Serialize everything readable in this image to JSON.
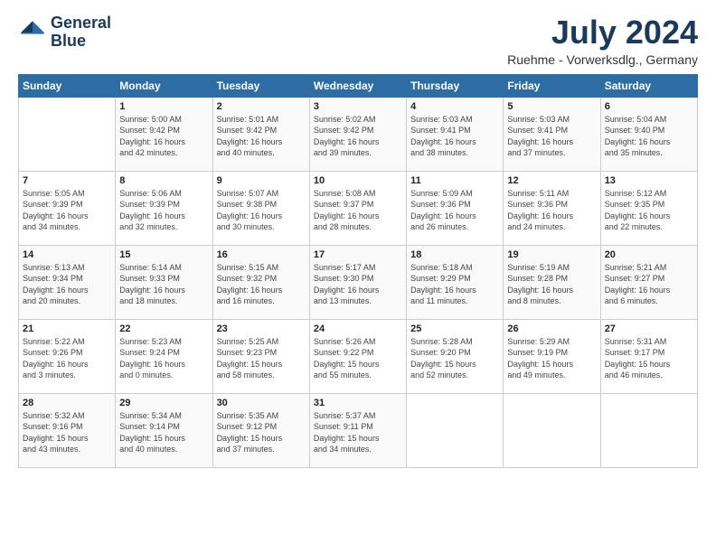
{
  "logo": {
    "line1": "General",
    "line2": "Blue"
  },
  "title": "July 2024",
  "location": "Ruehme - Vorwerksdlg., Germany",
  "header": {
    "days": [
      "Sunday",
      "Monday",
      "Tuesday",
      "Wednesday",
      "Thursday",
      "Friday",
      "Saturday"
    ]
  },
  "weeks": [
    [
      {
        "day": "",
        "info": ""
      },
      {
        "day": "1",
        "info": "Sunrise: 5:00 AM\nSunset: 9:42 PM\nDaylight: 16 hours\nand 42 minutes."
      },
      {
        "day": "2",
        "info": "Sunrise: 5:01 AM\nSunset: 9:42 PM\nDaylight: 16 hours\nand 40 minutes."
      },
      {
        "day": "3",
        "info": "Sunrise: 5:02 AM\nSunset: 9:42 PM\nDaylight: 16 hours\nand 39 minutes."
      },
      {
        "day": "4",
        "info": "Sunrise: 5:03 AM\nSunset: 9:41 PM\nDaylight: 16 hours\nand 38 minutes."
      },
      {
        "day": "5",
        "info": "Sunrise: 5:03 AM\nSunset: 9:41 PM\nDaylight: 16 hours\nand 37 minutes."
      },
      {
        "day": "6",
        "info": "Sunrise: 5:04 AM\nSunset: 9:40 PM\nDaylight: 16 hours\nand 35 minutes."
      }
    ],
    [
      {
        "day": "7",
        "info": "Sunrise: 5:05 AM\nSunset: 9:39 PM\nDaylight: 16 hours\nand 34 minutes."
      },
      {
        "day": "8",
        "info": "Sunrise: 5:06 AM\nSunset: 9:39 PM\nDaylight: 16 hours\nand 32 minutes."
      },
      {
        "day": "9",
        "info": "Sunrise: 5:07 AM\nSunset: 9:38 PM\nDaylight: 16 hours\nand 30 minutes."
      },
      {
        "day": "10",
        "info": "Sunrise: 5:08 AM\nSunset: 9:37 PM\nDaylight: 16 hours\nand 28 minutes."
      },
      {
        "day": "11",
        "info": "Sunrise: 5:09 AM\nSunset: 9:36 PM\nDaylight: 16 hours\nand 26 minutes."
      },
      {
        "day": "12",
        "info": "Sunrise: 5:11 AM\nSunset: 9:36 PM\nDaylight: 16 hours\nand 24 minutes."
      },
      {
        "day": "13",
        "info": "Sunrise: 5:12 AM\nSunset: 9:35 PM\nDaylight: 16 hours\nand 22 minutes."
      }
    ],
    [
      {
        "day": "14",
        "info": "Sunrise: 5:13 AM\nSunset: 9:34 PM\nDaylight: 16 hours\nand 20 minutes."
      },
      {
        "day": "15",
        "info": "Sunrise: 5:14 AM\nSunset: 9:33 PM\nDaylight: 16 hours\nand 18 minutes."
      },
      {
        "day": "16",
        "info": "Sunrise: 5:15 AM\nSunset: 9:32 PM\nDaylight: 16 hours\nand 16 minutes."
      },
      {
        "day": "17",
        "info": "Sunrise: 5:17 AM\nSunset: 9:30 PM\nDaylight: 16 hours\nand 13 minutes."
      },
      {
        "day": "18",
        "info": "Sunrise: 5:18 AM\nSunset: 9:29 PM\nDaylight: 16 hours\nand 11 minutes."
      },
      {
        "day": "19",
        "info": "Sunrise: 5:19 AM\nSunset: 9:28 PM\nDaylight: 16 hours\nand 8 minutes."
      },
      {
        "day": "20",
        "info": "Sunrise: 5:21 AM\nSunset: 9:27 PM\nDaylight: 16 hours\nand 6 minutes."
      }
    ],
    [
      {
        "day": "21",
        "info": "Sunrise: 5:22 AM\nSunset: 9:26 PM\nDaylight: 16 hours\nand 3 minutes."
      },
      {
        "day": "22",
        "info": "Sunrise: 5:23 AM\nSunset: 9:24 PM\nDaylight: 16 hours\nand 0 minutes."
      },
      {
        "day": "23",
        "info": "Sunrise: 5:25 AM\nSunset: 9:23 PM\nDaylight: 15 hours\nand 58 minutes."
      },
      {
        "day": "24",
        "info": "Sunrise: 5:26 AM\nSunset: 9:22 PM\nDaylight: 15 hours\nand 55 minutes."
      },
      {
        "day": "25",
        "info": "Sunrise: 5:28 AM\nSunset: 9:20 PM\nDaylight: 15 hours\nand 52 minutes."
      },
      {
        "day": "26",
        "info": "Sunrise: 5:29 AM\nSunset: 9:19 PM\nDaylight: 15 hours\nand 49 minutes."
      },
      {
        "day": "27",
        "info": "Sunrise: 5:31 AM\nSunset: 9:17 PM\nDaylight: 15 hours\nand 46 minutes."
      }
    ],
    [
      {
        "day": "28",
        "info": "Sunrise: 5:32 AM\nSunset: 9:16 PM\nDaylight: 15 hours\nand 43 minutes."
      },
      {
        "day": "29",
        "info": "Sunrise: 5:34 AM\nSunset: 9:14 PM\nDaylight: 15 hours\nand 40 minutes."
      },
      {
        "day": "30",
        "info": "Sunrise: 5:35 AM\nSunset: 9:12 PM\nDaylight: 15 hours\nand 37 minutes."
      },
      {
        "day": "31",
        "info": "Sunrise: 5:37 AM\nSunset: 9:11 PM\nDaylight: 15 hours\nand 34 minutes."
      },
      {
        "day": "",
        "info": ""
      },
      {
        "day": "",
        "info": ""
      },
      {
        "day": "",
        "info": ""
      }
    ]
  ]
}
